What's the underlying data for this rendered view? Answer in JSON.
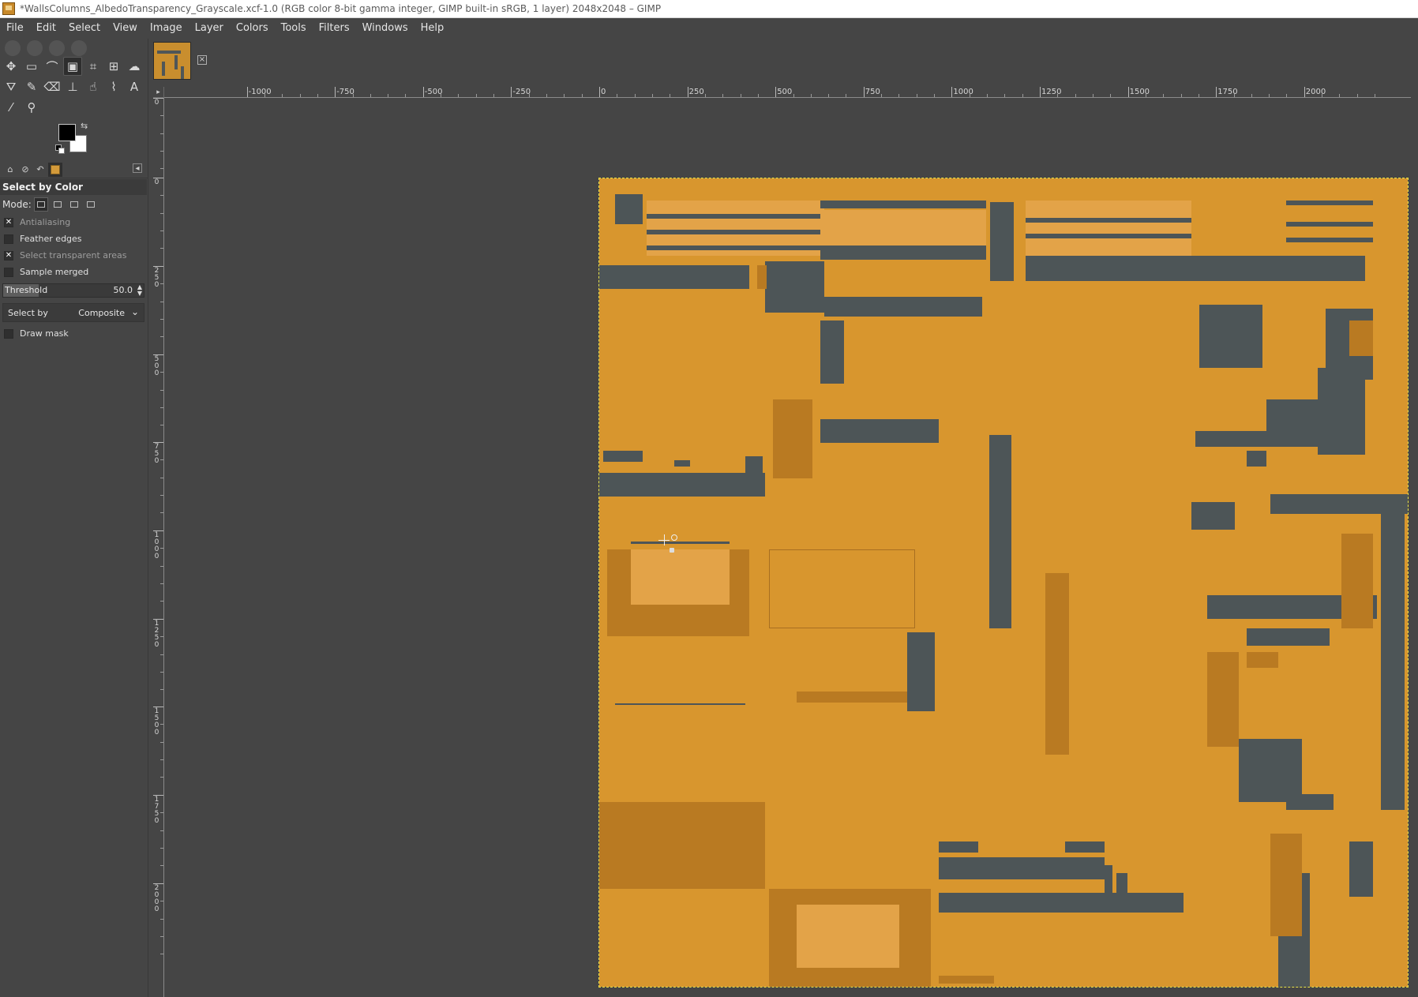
{
  "window": {
    "title": "*WallsColumns_AlbedoTransparency_Grayscale.xcf-1.0 (RGB color 8-bit gamma integer, GIMP built-in sRGB, 1 layer) 2048x2048 – GIMP"
  },
  "menu": [
    "File",
    "Edit",
    "Select",
    "View",
    "Image",
    "Layer",
    "Colors",
    "Tools",
    "Filters",
    "Windows",
    "Help"
  ],
  "tools": [
    {
      "name": "move-tool-icon",
      "glyph": "✥"
    },
    {
      "name": "rect-select-tool-icon",
      "glyph": "▭"
    },
    {
      "name": "free-select-tool-icon",
      "glyph": "⌒"
    },
    {
      "name": "select-by-color-tool-icon",
      "glyph": "▣",
      "active": true
    },
    {
      "name": "crop-tool-icon",
      "glyph": "⌗"
    },
    {
      "name": "unified-transform-tool-icon",
      "glyph": "⊞"
    },
    {
      "name": "warp-transform-tool-icon",
      "glyph": "☁"
    },
    {
      "name": "bucket-fill-tool-icon",
      "glyph": "⛛"
    },
    {
      "name": "paintbrush-tool-icon",
      "glyph": "✎"
    },
    {
      "name": "eraser-tool-icon",
      "glyph": "⌫"
    },
    {
      "name": "clone-tool-icon",
      "glyph": "⊥"
    },
    {
      "name": "smudge-tool-icon",
      "glyph": "☝"
    },
    {
      "name": "paths-tool-icon",
      "glyph": "⌇"
    },
    {
      "name": "text-tool-icon",
      "glyph": "A"
    },
    {
      "name": "color-picker-tool-icon",
      "glyph": "⁄"
    },
    {
      "name": "zoom-tool-icon",
      "glyph": "⚲"
    }
  ],
  "colors": {
    "foreground": "#000000",
    "background": "#ffffff",
    "texture": "#d8962e",
    "dark_panel": "#4d5557"
  },
  "tool_options": {
    "title": "Select by Color",
    "mode_label": "Mode:",
    "options": [
      {
        "label": "Antialiasing",
        "checked": true,
        "dim": true
      },
      {
        "label": "Feather edges",
        "checked": false,
        "dim": false
      },
      {
        "label": "Select transparent areas",
        "checked": true,
        "dim": true
      },
      {
        "label": "Sample merged",
        "checked": false,
        "dim": false
      }
    ],
    "threshold_label": "Threshold",
    "threshold_value": "50.0",
    "threshold_fraction": 0.25,
    "select_by_label": "Select by",
    "select_by_value": "Composite",
    "draw_mask_label": "Draw mask",
    "draw_mask_checked": false
  },
  "hruler_labels": [
    "-1000",
    "-750",
    "-500",
    "-250",
    "0",
    "250",
    "500",
    "750",
    "1000",
    "1250",
    "1500",
    "1750",
    "2000"
  ],
  "vruler_labels": [
    "0",
    "0",
    "250",
    "500",
    "750",
    "1000",
    "1250",
    "1500",
    "1750",
    "2000"
  ]
}
